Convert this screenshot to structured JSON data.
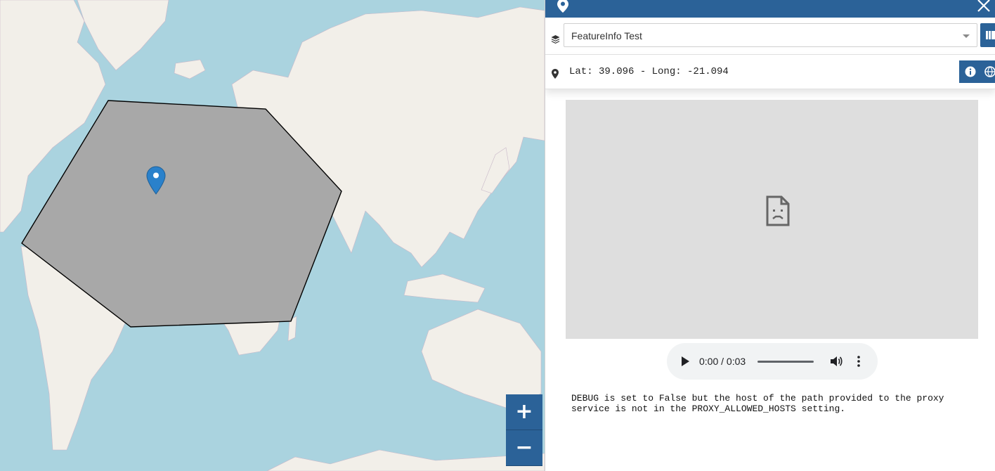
{
  "map": {
    "zoom_in_label": "+",
    "zoom_out_label": "−",
    "colors": {
      "water": "#aad3df",
      "land": "#f2efe9",
      "polygon_fill": "#a8a8a8",
      "polygon_stroke": "#000000",
      "marker": "#2a81cb"
    },
    "icons": {
      "marker": "map-marker-icon",
      "zoom_in": "plus-icon",
      "zoom_out": "minus-icon"
    }
  },
  "panel": {
    "header": {
      "color": "#2b6298",
      "icons": [
        "map-marker-icon",
        "close-icon"
      ]
    },
    "layer_select": {
      "value": "FeatureInfo Test"
    },
    "coordinates": {
      "text": "Lat: 39.096 - Long: -21.094"
    },
    "audio": {
      "time": "0:00 / 0:03",
      "progress": 0
    },
    "message": "DEBUG is set to False but the host of the path provided to the proxy service is not in the PROXY_ALLOWED_HOSTS setting."
  }
}
